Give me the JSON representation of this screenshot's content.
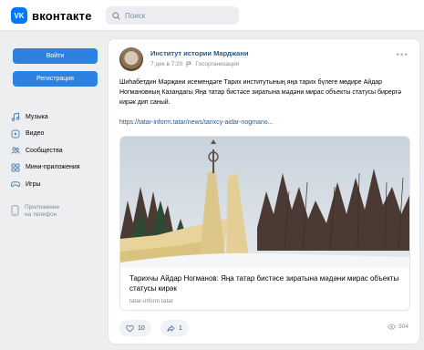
{
  "header": {
    "logo_mark": "VK",
    "logo_text": "вконтакте",
    "search_placeholder": "Поиск"
  },
  "auth": {
    "login_label": "Войти",
    "register_label": "Регистрация"
  },
  "sidebar": {
    "items": [
      {
        "label": "Музыка",
        "icon": "music-icon"
      },
      {
        "label": "Видео",
        "icon": "video-icon"
      },
      {
        "label": "Сообщества",
        "icon": "communities-icon"
      },
      {
        "label": "Мини-приложения",
        "icon": "mini-apps-icon"
      },
      {
        "label": "Игры",
        "icon": "games-icon"
      }
    ],
    "app_label_line1": "Приложение",
    "app_label_line2": "на телефон"
  },
  "post": {
    "author": "Институт истории Марджани",
    "time": "7 дек в 7:20",
    "type": "Госорганизация",
    "text": "Шиһабетдин Мәрҗани исемендәге Тарих институтының яңа тарих бүлеге мөдире Айдар Ногмановның Казандагы Яңа татар бистәсе зиратына мәдәни мирас объекты статусы бирергә кирәк дип саный.",
    "link": "https://tatar-inform.tatar/news/tarixcy-aidar-nogmano...",
    "attachment": {
      "title": "Тарихчы Айдар Ногманов: Яңа татар бистәсе зиратына мәдәни мирас объекты статусы кирәк",
      "domain": "tatar-inform.tatar"
    },
    "likes": "10",
    "shares": "1",
    "views": "504"
  },
  "colors": {
    "accent": "#2d81e0",
    "link": "#2a5885",
    "muted": "#818c99",
    "background": "#edeef0"
  }
}
